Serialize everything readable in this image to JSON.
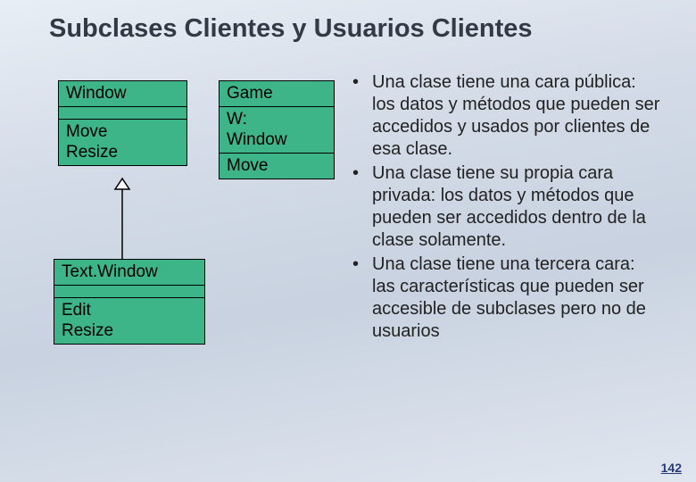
{
  "title": "Subclases Clientes y Usuarios Clientes",
  "uml": {
    "window": {
      "name": "Window",
      "methods": "Move\nResize"
    },
    "game": {
      "header": "Game",
      "attrs": "W:\nWindow",
      "methods": "Move"
    },
    "textwin": {
      "name": "Text.Window",
      "methods": "Edit\nResize"
    }
  },
  "bullets": [
    "Una clase tiene una cara pública: los datos y métodos que pueden ser accedidos y usados por clientes de esa clase.",
    "Una clase tiene su propia cara privada: los datos y métodos que pueden ser accedidos dentro de la clase solamente.",
    "Una clase tiene una tercera cara: las características que pueden ser accesible de subclases pero no de usuarios"
  ],
  "page_number": "142"
}
